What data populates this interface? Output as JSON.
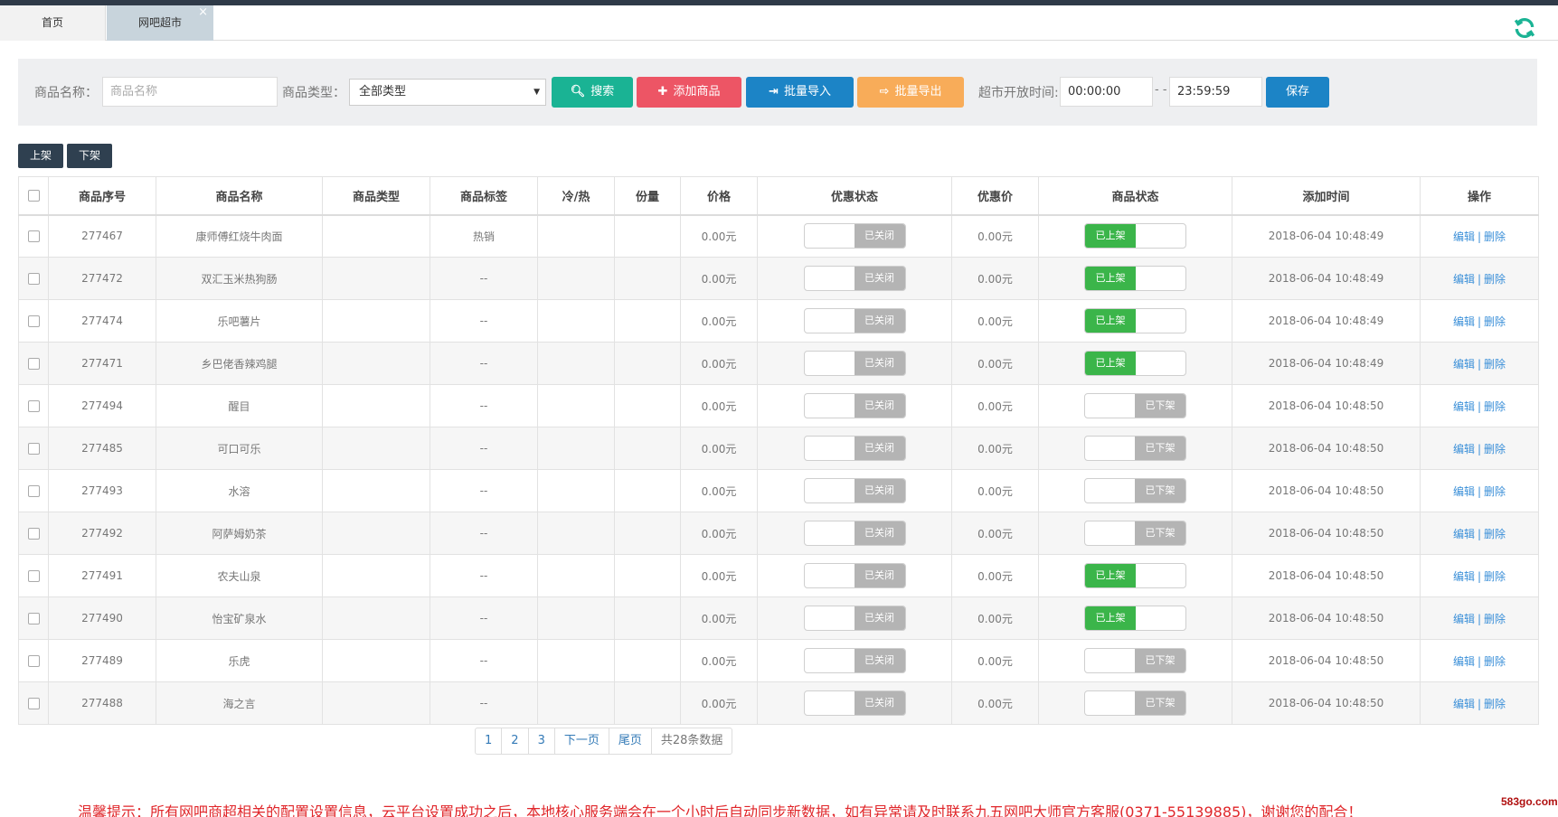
{
  "tabs": [
    {
      "label": "首页"
    },
    {
      "label": "网吧超市",
      "close": "×"
    }
  ],
  "filter": {
    "name_label": "商品名称：",
    "name_placeholder": "商品名称",
    "type_label": "商品类型：",
    "type_selected": "全部类型",
    "search_label": "搜索",
    "add_label": "添加商品",
    "import_label": "批量导入",
    "export_label": "批量导出",
    "open_time_label": "超市开放时间:",
    "open_start": "00:00:00",
    "separator": "- -",
    "open_end": "23:59:59",
    "save_label": "保存"
  },
  "actions": {
    "on_shelf": "上架",
    "off_shelf": "下架"
  },
  "columns": [
    "商品序号",
    "商品名称",
    "商品类型",
    "商品标签",
    "冷/热",
    "份量",
    "价格",
    "优惠状态",
    "优惠价",
    "商品状态",
    "添加时间",
    "操作"
  ],
  "rows": [
    {
      "id": "277467",
      "name": "康师傅红烧牛肉面",
      "type": "",
      "tag": "热销",
      "temp": "",
      "portion": "",
      "price": "0.00元",
      "discount": "已关闭",
      "discount_price": "0.00元",
      "status": "已上架",
      "status_on": true,
      "time": "2018-06-04 10:48:49"
    },
    {
      "id": "277472",
      "name": "双汇玉米热狗肠",
      "type": "",
      "tag": "--",
      "temp": "",
      "portion": "",
      "price": "0.00元",
      "discount": "已关闭",
      "discount_price": "0.00元",
      "status": "已上架",
      "status_on": true,
      "time": "2018-06-04 10:48:49"
    },
    {
      "id": "277474",
      "name": "乐吧薯片",
      "type": "",
      "tag": "--",
      "temp": "",
      "portion": "",
      "price": "0.00元",
      "discount": "已关闭",
      "discount_price": "0.00元",
      "status": "已上架",
      "status_on": true,
      "time": "2018-06-04 10:48:49"
    },
    {
      "id": "277471",
      "name": "乡巴佬香辣鸡腿",
      "type": "",
      "tag": "--",
      "temp": "",
      "portion": "",
      "price": "0.00元",
      "discount": "已关闭",
      "discount_price": "0.00元",
      "status": "已上架",
      "status_on": true,
      "time": "2018-06-04 10:48:49"
    },
    {
      "id": "277494",
      "name": "醒目",
      "type": "",
      "tag": "--",
      "temp": "",
      "portion": "",
      "price": "0.00元",
      "discount": "已关闭",
      "discount_price": "0.00元",
      "status": "已下架",
      "status_on": false,
      "time": "2018-06-04 10:48:50"
    },
    {
      "id": "277485",
      "name": "可口可乐",
      "type": "",
      "tag": "--",
      "temp": "",
      "portion": "",
      "price": "0.00元",
      "discount": "已关闭",
      "discount_price": "0.00元",
      "status": "已下架",
      "status_on": false,
      "time": "2018-06-04 10:48:50"
    },
    {
      "id": "277493",
      "name": "水溶",
      "type": "",
      "tag": "--",
      "temp": "",
      "portion": "",
      "price": "0.00元",
      "discount": "已关闭",
      "discount_price": "0.00元",
      "status": "已下架",
      "status_on": false,
      "time": "2018-06-04 10:48:50"
    },
    {
      "id": "277492",
      "name": "阿萨姆奶茶",
      "type": "",
      "tag": "--",
      "temp": "",
      "portion": "",
      "price": "0.00元",
      "discount": "已关闭",
      "discount_price": "0.00元",
      "status": "已下架",
      "status_on": false,
      "time": "2018-06-04 10:48:50"
    },
    {
      "id": "277491",
      "name": "农夫山泉",
      "type": "",
      "tag": "--",
      "temp": "",
      "portion": "",
      "price": "0.00元",
      "discount": "已关闭",
      "discount_price": "0.00元",
      "status": "已上架",
      "status_on": true,
      "time": "2018-06-04 10:48:50"
    },
    {
      "id": "277490",
      "name": "怡宝矿泉水",
      "type": "",
      "tag": "--",
      "temp": "",
      "portion": "",
      "price": "0.00元",
      "discount": "已关闭",
      "discount_price": "0.00元",
      "status": "已上架",
      "status_on": true,
      "time": "2018-06-04 10:48:50"
    },
    {
      "id": "277489",
      "name": "乐虎",
      "type": "",
      "tag": "--",
      "temp": "",
      "portion": "",
      "price": "0.00元",
      "discount": "已关闭",
      "discount_price": "0.00元",
      "status": "已下架",
      "status_on": false,
      "time": "2018-06-04 10:48:50"
    },
    {
      "id": "277488",
      "name": "海之言",
      "type": "",
      "tag": "--",
      "temp": "",
      "portion": "",
      "price": "0.00元",
      "discount": "已关闭",
      "discount_price": "0.00元",
      "status": "已下架",
      "status_on": false,
      "time": "2018-06-04 10:48:50"
    }
  ],
  "op": {
    "edit": "编辑",
    "sep": "|",
    "delete": "删除"
  },
  "pagination": {
    "pages": [
      "1",
      "2",
      "3"
    ],
    "next": "下一页",
    "last": "尾页",
    "total": "共28条数据"
  },
  "tip": "温馨提示：所有网吧商超相关的配置设置信息，云平台设置成功之后，本地核心服务端会在一个小时后自动同步新数据，如有异常请及时联系九五网吧大师官方客服(0371-55139885)，谢谢您的配合！",
  "watermark": "583go.com",
  "colors": {
    "green": "#3bb54a",
    "teal": "#1ab394",
    "red": "#ed5565",
    "blue": "#1c84c6",
    "orange": "#f8ac59",
    "dark": "#2f4050"
  }
}
